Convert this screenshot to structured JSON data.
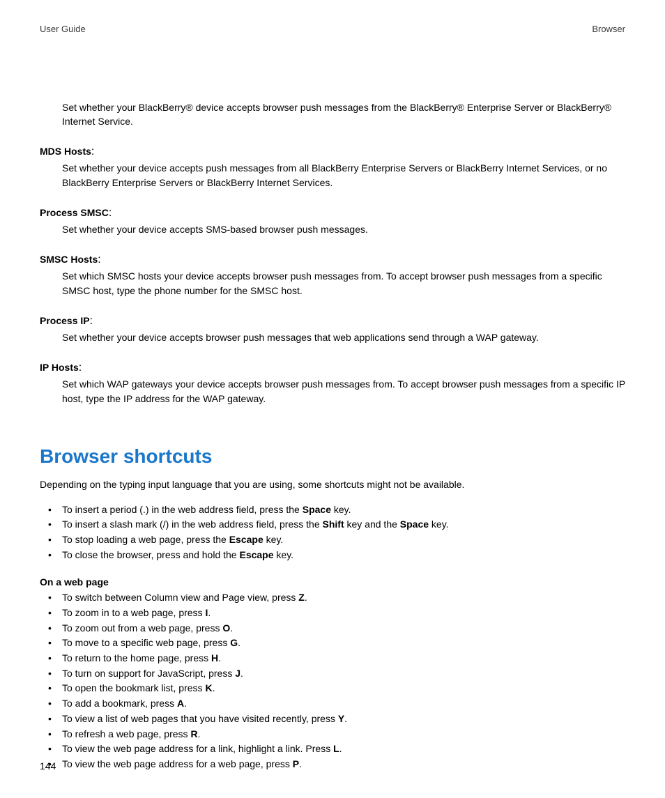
{
  "header": {
    "left": "User Guide",
    "right": "Browser"
  },
  "intro": "Set whether your BlackBerry® device accepts browser push messages from the BlackBerry® Enterprise Server or BlackBerry® Internet Service.",
  "defs": [
    {
      "term": "MDS Hosts",
      "desc": "Set whether your device accepts push messages from all BlackBerry Enterprise Servers or BlackBerry Internet Services, or no BlackBerry Enterprise Servers or BlackBerry Internet Services."
    },
    {
      "term": "Process SMSC",
      "desc": "Set whether your device accepts SMS-based browser push messages."
    },
    {
      "term": "SMSC Hosts",
      "desc": "Set which SMSC hosts your device accepts browser push messages from. To accept browser push messages from a specific SMSC host, type the phone number for the SMSC host."
    },
    {
      "term": "Process IP",
      "desc": "Set whether your device accepts browser push messages that web applications send through a WAP gateway."
    },
    {
      "term": "IP Hosts",
      "desc": "Set which WAP gateways your device accepts browser push messages from. To accept browser push messages from a specific IP host, type the IP address for the WAP gateway."
    }
  ],
  "section_title": "Browser shortcuts",
  "lead": "Depending on the typing input language that you are using, some shortcuts might not be available.",
  "group1": [
    {
      "pre": "To insert a period (.) in the web address field, press the ",
      "bold": "Space",
      "post": " key."
    },
    {
      "pre": "To insert a slash mark (/) in the web address field, press the ",
      "bold": "Shift",
      "mid": " key and the ",
      "bold2": "Space",
      "post": " key."
    },
    {
      "pre": "To stop loading a web page, press the ",
      "bold": "Escape",
      "post": " key."
    },
    {
      "pre": "To close the browser, press and hold the ",
      "bold": "Escape",
      "post": " key."
    }
  ],
  "subhead": "On a web page",
  "group2": [
    {
      "pre": "To switch between Column view and Page view, press ",
      "bold": "Z",
      "post": "."
    },
    {
      "pre": "To zoom in to a web page, press ",
      "bold": "I",
      "post": "."
    },
    {
      "pre": "To zoom out from a web page, press ",
      "bold": "O",
      "post": "."
    },
    {
      "pre": "To move to a specific web page, press ",
      "bold": "G",
      "post": "."
    },
    {
      "pre": "To return to the home page, press ",
      "bold": "H",
      "post": "."
    },
    {
      "pre": "To turn on support for JavaScript, press ",
      "bold": "J",
      "post": "."
    },
    {
      "pre": "To open the bookmark list, press ",
      "bold": "K",
      "post": "."
    },
    {
      "pre": "To add a bookmark, press ",
      "bold": "A",
      "post": "."
    },
    {
      "pre": "To view a list of web pages that you have visited recently, press ",
      "bold": "Y",
      "post": "."
    },
    {
      "pre": "To refresh a web page, press ",
      "bold": "R",
      "post": "."
    },
    {
      "pre": "To view the web page address for a link, highlight a link. Press ",
      "bold": "L",
      "post": "."
    },
    {
      "pre": "To view the web page address for a web page, press ",
      "bold": "P",
      "post": "."
    }
  ],
  "page_number": "144"
}
